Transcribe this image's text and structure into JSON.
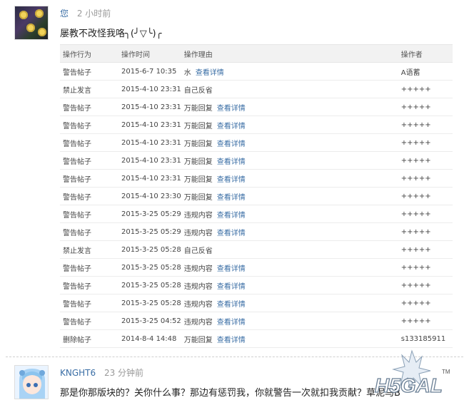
{
  "post1": {
    "author": "您",
    "time": "2 小时前",
    "content": "屡教不改怪我咯╮(╯▽╰)╭"
  },
  "log": {
    "headers": [
      "操作行为",
      "操作时间",
      "操作理由",
      "操作者"
    ],
    "detail_label": "查看详情",
    "rows": [
      {
        "action": "警告帖子",
        "time": "2015-6-7 10:35",
        "reason": "水",
        "has_detail": true,
        "operator": "A语蓄"
      },
      {
        "action": "禁止发言",
        "time": "2015-4-10 23:31",
        "reason": "自己反省",
        "has_detail": false,
        "operator": "+++++"
      },
      {
        "action": "警告帖子",
        "time": "2015-4-10 23:31",
        "reason": "万能回复",
        "has_detail": true,
        "operator": "+++++"
      },
      {
        "action": "警告帖子",
        "time": "2015-4-10 23:31",
        "reason": "万能回复",
        "has_detail": true,
        "operator": "+++++"
      },
      {
        "action": "警告帖子",
        "time": "2015-4-10 23:31",
        "reason": "万能回复",
        "has_detail": true,
        "operator": "+++++"
      },
      {
        "action": "警告帖子",
        "time": "2015-4-10 23:31",
        "reason": "万能回复",
        "has_detail": true,
        "operator": "+++++"
      },
      {
        "action": "警告帖子",
        "time": "2015-4-10 23:31",
        "reason": "万能回复",
        "has_detail": true,
        "operator": "+++++"
      },
      {
        "action": "警告帖子",
        "time": "2015-4-10 23:30",
        "reason": "万能回复",
        "has_detail": true,
        "operator": "+++++"
      },
      {
        "action": "警告帖子",
        "time": "2015-3-25 05:29",
        "reason": "违规内容",
        "has_detail": true,
        "operator": "+++++"
      },
      {
        "action": "警告帖子",
        "time": "2015-3-25 05:29",
        "reason": "违规内容",
        "has_detail": true,
        "operator": "+++++"
      },
      {
        "action": "禁止发言",
        "time": "2015-3-25 05:28",
        "reason": "自己反省",
        "has_detail": false,
        "operator": "+++++"
      },
      {
        "action": "警告帖子",
        "time": "2015-3-25 05:28",
        "reason": "违规内容",
        "has_detail": true,
        "operator": "+++++"
      },
      {
        "action": "警告帖子",
        "time": "2015-3-25 05:28",
        "reason": "违规内容",
        "has_detail": true,
        "operator": "+++++"
      },
      {
        "action": "警告帖子",
        "time": "2015-3-25 05:28",
        "reason": "违规内容",
        "has_detail": true,
        "operator": "+++++"
      },
      {
        "action": "警告帖子",
        "time": "2015-3-25 04:52",
        "reason": "违规内容",
        "has_detail": true,
        "operator": "+++++"
      },
      {
        "action": "删除帖子",
        "time": "2014-8-4 14:48",
        "reason": "万能回复",
        "has_detail": true,
        "operator": "s133185911"
      }
    ]
  },
  "post2": {
    "author": "KNGHT6",
    "time": "23 分钟前",
    "content": "那是你那版块的？关你什么事？那边有惩罚我，你就警告一次就扣我贡献？草泥马B"
  },
  "watermark": {
    "text": "H5GAL",
    "mark": "TM"
  }
}
